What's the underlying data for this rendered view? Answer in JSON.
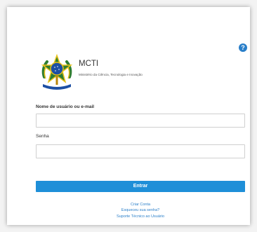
{
  "header": {
    "org_name": "MCTI",
    "org_subtitle": "Ministério da Ciência, Tecnologia e Inovação",
    "help_label": "?"
  },
  "form": {
    "username_label": "Nome de usuário ou e-mail",
    "username_value": "",
    "password_label": "Senha",
    "password_value": "",
    "submit_label": "Entrar"
  },
  "links": {
    "create_account": "Criar Conta",
    "forgot_password": "Esqueceu sua senha?",
    "support": "Suporte Técnico ao Usuário"
  },
  "colors": {
    "accent": "#1f8fd8",
    "link": "#2a7fc9",
    "emblem_green": "#2e7d32",
    "emblem_yellow": "#e8c21a",
    "emblem_blue": "#1d4fa3"
  },
  "icons": {
    "help": "help-icon",
    "emblem": "coat-of-arms-emblem"
  }
}
